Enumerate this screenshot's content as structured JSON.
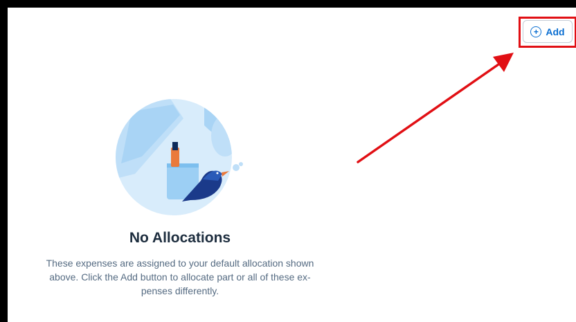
{
  "toolbar": {
    "add_label": "Add",
    "add_icon": "plus-circle-icon"
  },
  "empty_state": {
    "illustration": "bird-mug-illustration",
    "title": "No Allocations",
    "description_line1": "These expenses are assigned to your default allocation shown",
    "description_line2": "above. Click the Add button to allocate part or all of these ex-",
    "description_line3": "penses differently."
  },
  "annotation": {
    "highlight_color": "#e10f14"
  },
  "colors": {
    "accent": "#0a6ed1",
    "title": "#1d2d3e",
    "text": "#556b82"
  }
}
